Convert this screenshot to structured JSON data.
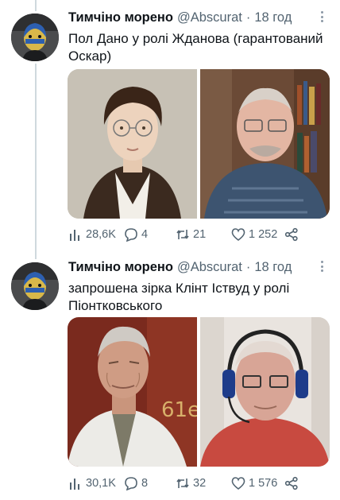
{
  "tweets": [
    {
      "author": "Тимчіно морено",
      "handle": "@Abscurat",
      "separator": "·",
      "time": "18 год",
      "text_line1": "Пол Дано у ролі Жданова (гарантований",
      "text_line2": "Оскар)",
      "views": "28,6K",
      "replies": "4",
      "retweets": "21",
      "likes": "1 252"
    },
    {
      "author": "Тимчіно морено",
      "handle": "@Abscurat",
      "separator": "·",
      "time": "18 год",
      "text_line1": "запрошена зірка Клінт Іствуд у ролі",
      "text_line2": "Піонтковського",
      "image_sign_text": "61e",
      "views": "30,1K",
      "replies": "8",
      "retweets": "32",
      "likes": "1 576"
    }
  ],
  "icons": {
    "views": "bar-chart-icon",
    "reply": "speech-bubble-icon",
    "retweet": "retweet-arrows-icon",
    "like": "heart-icon",
    "share": "share-nodes-icon",
    "more": "vertical-dots-icon"
  },
  "colors": {
    "text": "#0f1419",
    "secondary": "#536471",
    "thread_line": "#cfd9de"
  }
}
